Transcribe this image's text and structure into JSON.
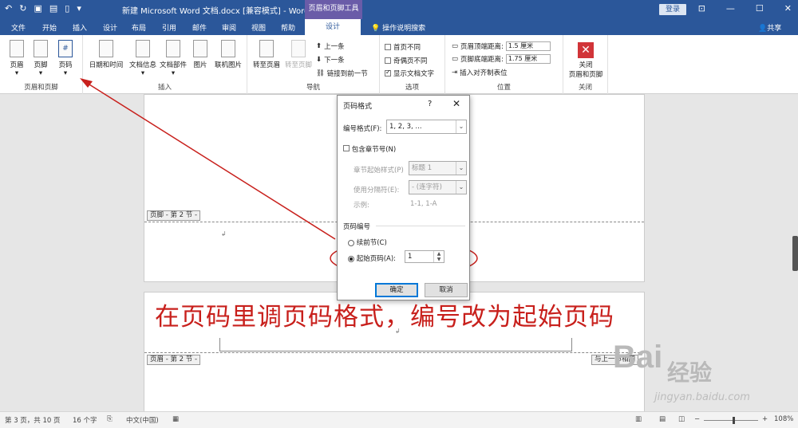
{
  "titlebar": {
    "title": "新建 Microsoft Word 文档.docx [兼容模式] - Word",
    "context_tool": "页眉和页脚工具",
    "login": "登录"
  },
  "tabs": {
    "file": "文件",
    "home": "开始",
    "insert": "插入",
    "design_doc": "设计",
    "layout": "布局",
    "references": "引用",
    "mailings": "邮件",
    "review": "审阅",
    "view": "视图",
    "help": "帮助",
    "design_active": "设计",
    "tell_me": "操作说明搜索",
    "share": "共享"
  },
  "ribbon": {
    "group1": {
      "label": "页眉和页脚",
      "header": "页眉",
      "footer": "页脚",
      "page_number": "页码"
    },
    "group2": {
      "label": "插入",
      "datetime": "日期和时间",
      "docinfo": "文档信息",
      "quickparts": "文档部件",
      "picture": "图片",
      "online_picture": "联机图片"
    },
    "group3": {
      "label": "导航",
      "goto_header": "转至页眉",
      "goto_footer": "转至页脚",
      "previous": "上一条",
      "next": "下一条",
      "link_previous": "链接到前一节"
    },
    "group4": {
      "label": "选项",
      "diff_first": "首页不同",
      "diff_odd_even": "奇偶页不同",
      "show_doc_text": "显示文档文字"
    },
    "group5": {
      "label": "位置",
      "header_top_label": "页眉顶端距离:",
      "header_top_value": "1.5 厘米",
      "footer_bottom_label": "页脚底端距离:",
      "footer_bottom_value": "1.75 厘米",
      "insert_align_tab": "插入对齐制表位"
    },
    "group6": {
      "label": "关闭",
      "close": "关闭",
      "close2": "页眉和页脚"
    }
  },
  "page": {
    "footer_tag": "页脚 - 第 2 节 -",
    "header_tag": "页眉 - 第 2 节 -",
    "same_as_previous": "与上一节相同"
  },
  "dialog": {
    "title": "页码格式",
    "help": "?",
    "close": "✕",
    "format_label": "编号格式(F):",
    "format_value": "1, 2, 3, ...",
    "include_chapter": "包含章节号(N)",
    "chapter_style_label": "章节起始样式(P)",
    "chapter_style_value": "标题 1",
    "separator_label": "使用分隔符(E):",
    "separator_value": "-  (连字符)",
    "example_label": "示例:",
    "example_value": "1-1, 1-A",
    "numbering_section": "页码编号",
    "continue_label": "续前节(C)",
    "start_at_label": "起始页码(A):",
    "start_at_value": "1",
    "ok": "确定",
    "cancel": "取消"
  },
  "annotation": {
    "text": "在页码里调页码格式，编号改为起始页码",
    "color": "#c8201c"
  },
  "watermark": {
    "brand": "Bai",
    "brand2": "经验",
    "url": "jingyan.baidu.com"
  },
  "statusbar": {
    "page": "第 3 页，共 10 页",
    "words": "16 个字",
    "language": "中文(中国)",
    "zoom": "108%"
  }
}
